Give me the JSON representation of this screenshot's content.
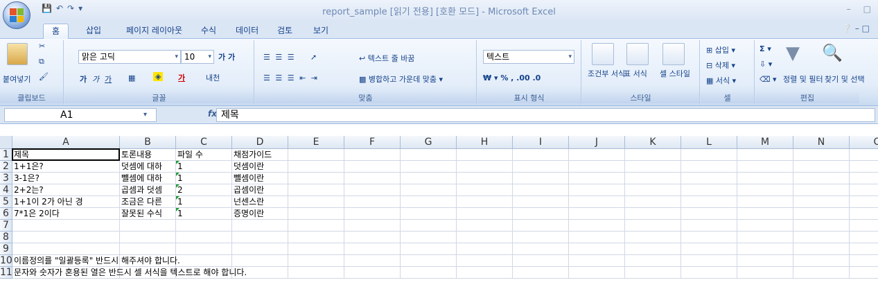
{
  "title": "report_sample  [읽기 전용]  [호환 모드] - Microsoft Excel",
  "tabs": [
    "홈",
    "삽입",
    "페이지 레이아웃",
    "수식",
    "데이터",
    "검토",
    "보기"
  ],
  "ribbon": {
    "paste": "붙여넣기",
    "clipboard": "클립보드",
    "font_name": "맑은 고딕",
    "font_size": "10",
    "font_group": "글꼴",
    "wrap_text": "텍스트 줄 바꿈",
    "merge_center": "병합하고 가운데 맞춤",
    "alignment_group": "맞춤",
    "number_format": "텍스트",
    "number_group": "표시 형식",
    "cond_format": "조건부 서식",
    "table_format": "표 서식",
    "cell_style": "셀 스타일",
    "styles_group": "스타일",
    "insert": "삽입",
    "delete": "삭제",
    "format": "서식",
    "cells_group": "셀",
    "sort_filter": "정렬 및 필터",
    "find_select": "찾기 및 선택",
    "editing_group": "편집"
  },
  "formula_bar": {
    "name_box": "A1",
    "fx": "fx",
    "content": "제목"
  },
  "columns": [
    "A",
    "B",
    "C",
    "D",
    "E",
    "F",
    "G",
    "H",
    "I",
    "J",
    "K",
    "L",
    "M",
    "N",
    "O"
  ],
  "rows": [
    {
      "num": "1",
      "cells": [
        "제목",
        "토론내용",
        "파일 수",
        "채점가이드"
      ]
    },
    {
      "num": "2",
      "cells": [
        "1+1은?",
        "덧셈에 대하",
        "1",
        "덧셈이란"
      ]
    },
    {
      "num": "3",
      "cells": [
        "3-1은?",
        "뺄셈에 대하",
        "1",
        "뺄셈이란"
      ]
    },
    {
      "num": "4",
      "cells": [
        "2+2는?",
        "곱셈과 덧셈",
        "2",
        "곱셈이란"
      ]
    },
    {
      "num": "5",
      "cells": [
        "1+1이 2가 아닌 경",
        "조금은 다른",
        "1",
        "넌센스란"
      ]
    },
    {
      "num": "6",
      "cells": [
        "7*1은 2이다",
        "잘못된 수식",
        "1",
        "증명이란"
      ]
    },
    {
      "num": "7",
      "cells": []
    },
    {
      "num": "8",
      "cells": []
    },
    {
      "num": "9",
      "cells": []
    },
    {
      "num": "10",
      "cells": [
        "이름정의를 \"일괄등록\" 반드시 해주셔야 합니다."
      ]
    },
    {
      "num": "11",
      "cells": [
        "문자와 숫자가 혼용된 열은 반드시 셀 서식을 텍스트로 해야 합니다."
      ]
    }
  ],
  "colors": {
    "accent": "#15428b",
    "grid_line": "#d0d7e5",
    "error_marker": "#1f9d3a"
  }
}
